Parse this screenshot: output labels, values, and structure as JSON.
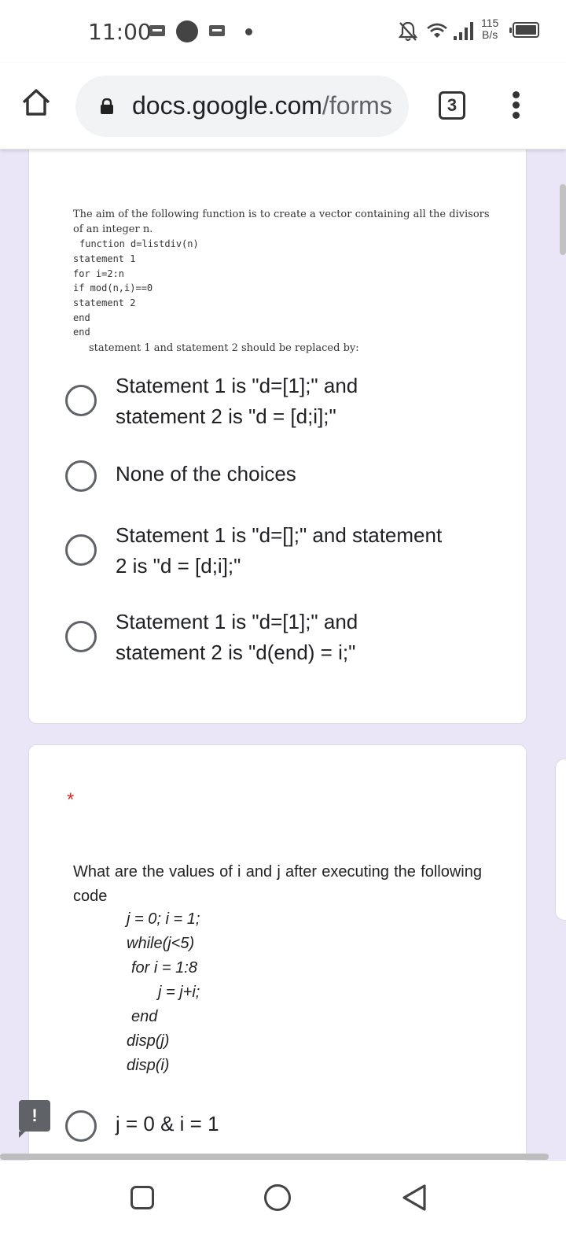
{
  "status_bar": {
    "time": "11:00",
    "net_speed_value": "115",
    "net_speed_unit": "B/s",
    "icons": [
      "message-icon",
      "circle-icon",
      "message-icon",
      "dot-icon",
      "bell-off-icon",
      "wifi-icon",
      "signal-icon",
      "battery-icon"
    ]
  },
  "browser": {
    "url_domain": "docs.google.com",
    "url_path": "/forms",
    "tab_count": "3"
  },
  "question1": {
    "intro_line1": "The aim of the following function is to create a vector containing all the divisors",
    "intro_line2": "of an integer n.",
    "code": [
      "function d=listdiv(n)",
      "statement 1",
      "for i=2:n",
      "if mod(n,i)==0",
      "statement 2",
      "end",
      "end"
    ],
    "prompt": "statement 1 and statement 2 should be replaced by:",
    "options": [
      {
        "line1": "Statement 1 is \"d=[1];\" and",
        "line2": "statement 2 is \"d = [d;i];\""
      },
      {
        "line1": "None of the choices",
        "line2": ""
      },
      {
        "line1": "Statement 1 is \"d=[];\" and statement",
        "line2": "2 is \"d = [d;i];\""
      },
      {
        "line1": "Statement 1 is \"d=[1];\" and",
        "line2": "statement 2 is \"d(end) = i;\""
      }
    ]
  },
  "question2": {
    "required_mark": "*",
    "text": "What are the values of i and j after executing the following code",
    "code": [
      "j = 0; i = 1;",
      "while(j<5)",
      "for i = 1:8",
      "j = j+i;",
      "end",
      "disp(j)",
      "disp(i)"
    ],
    "options": [
      {
        "label": "j = 0 & i = 1"
      }
    ]
  },
  "feedback_label": "!"
}
